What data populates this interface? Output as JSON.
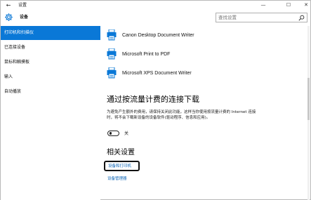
{
  "window": {
    "title": "设置",
    "back_glyph": "←",
    "min_glyph": "—",
    "max_glyph": "☐",
    "close_glyph": "✕"
  },
  "header": {
    "title": "设备",
    "icon": "gear-icon",
    "search_placeholder": "查找设置",
    "search_icon": "search-icon"
  },
  "sidebar": {
    "items": [
      {
        "label": "打印机和扫描仪",
        "active": true
      },
      {
        "label": "已连接设备",
        "active": false
      },
      {
        "label": "鼠标和触摸板",
        "active": false
      },
      {
        "label": "输入",
        "active": false
      },
      {
        "label": "自动播放",
        "active": false
      }
    ]
  },
  "printers": [
    {
      "name": "Canon Desktop Document Writer",
      "icon": "printer-icon"
    },
    {
      "name": "Microsoft Print to PDF",
      "icon": "printer-icon"
    },
    {
      "name": "Microsoft XPS Document Writer",
      "icon": "printer-icon"
    }
  ],
  "metered": {
    "title": "通过按流量计费的连接下载",
    "description": "为避免产生额外的费用，请保持关闭此功能，这样当你使用按流量计费的 Internet 连接时，将不会下载新设备的设备软件(驱动程序、信息和应用)。",
    "toggle_state": "关",
    "toggle_on": false
  },
  "related": {
    "title": "相关设置",
    "devices_link": "设备和打印机",
    "device_manager_link": "设备管理器"
  },
  "colors": {
    "accent": "#0a78d7",
    "link": "#0a63b5"
  }
}
